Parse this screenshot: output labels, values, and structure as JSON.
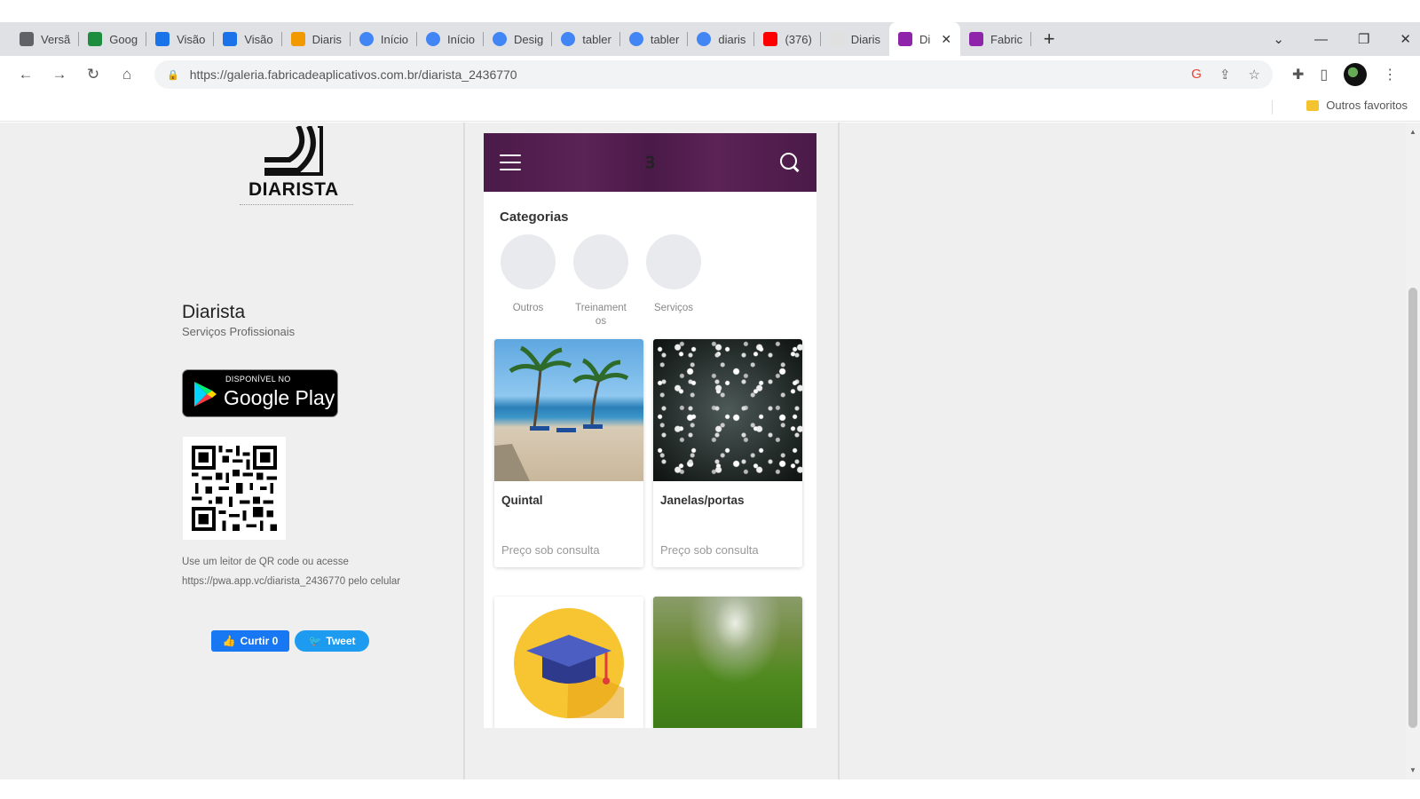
{
  "browser": {
    "tabs": [
      {
        "label": "Versã",
        "color": "#5f6368"
      },
      {
        "label": "Goog",
        "color": "#1e8e3e"
      },
      {
        "label": "Visão",
        "color": "#1a73e8"
      },
      {
        "label": "Visão",
        "color": "#1a73e8"
      },
      {
        "label": "Diaris",
        "color": "#f29900"
      },
      {
        "label": "Início",
        "color": "#4285f4"
      },
      {
        "label": "Início",
        "color": "#4285f4"
      },
      {
        "label": "Desig",
        "color": "#4285f4"
      },
      {
        "label": "tabler",
        "color": "#4285f4"
      },
      {
        "label": "tabler",
        "color": "#4285f4"
      },
      {
        "label": "diaris",
        "color": "#4285f4"
      },
      {
        "label": "(376)",
        "color": "#ff0000"
      },
      {
        "label": "Diaris",
        "color": "#e0e0e0"
      },
      {
        "label": "Di",
        "color": "#8e24aa"
      },
      {
        "label": "Fabric",
        "color": "#8e24aa"
      }
    ],
    "active_tab_index": 13,
    "url": "https://galeria.fabricadeaplicativos.com.br/diarista_2436770",
    "bookmark_folder": "Outros favoritos"
  },
  "left": {
    "logo_text": "DIARISTA",
    "app_name": "Diarista",
    "app_subtitle": "Serviços Profissionais",
    "gplay_small": "DISPONÍVEL NO",
    "gplay_big": "Google Play",
    "qr_hint": "Use um leitor de QR code ou acesse https://pwa.app.vc/diarista_2436770 pelo celular",
    "fb_label": "Curtir 0",
    "tw_label": "Tweet"
  },
  "app": {
    "header_logo": "Ɜ",
    "categories_title": "Categorias",
    "categories": [
      {
        "label": "Outros"
      },
      {
        "label": "Treinamentos"
      },
      {
        "label": "Serviços"
      }
    ],
    "products": [
      {
        "title": "Quintal",
        "price": "Preço sob consulta"
      },
      {
        "title": "Janelas/portas",
        "price": "Preço sob consulta"
      }
    ]
  }
}
